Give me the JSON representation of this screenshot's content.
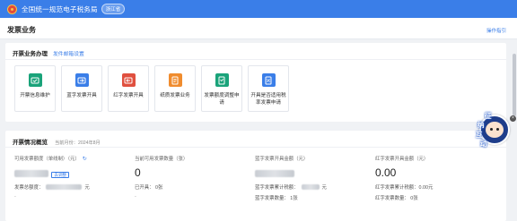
{
  "header": {
    "site_title": "全国统一规范电子税务局",
    "region_badge": "浙江省"
  },
  "page": {
    "title": "发票业务",
    "help_link": "操作指引"
  },
  "business": {
    "title": "开票业务办理",
    "settings_link": "发件邮箱设置",
    "tiles": [
      {
        "label": "开票信息维护",
        "icon": "info-maintenance-icon",
        "color": "#1aa37a"
      },
      {
        "label": "蓝字发票开具",
        "icon": "blue-invoice-icon",
        "color": "#3a7ee8"
      },
      {
        "label": "红字发票开具",
        "icon": "red-invoice-icon",
        "color": "#e0503f"
      },
      {
        "label": "纸质发票业务",
        "icon": "paper-invoice-icon",
        "color": "#f08c2e"
      },
      {
        "label": "发票额度调整申请",
        "icon": "quota-adjust-icon",
        "color": "#1aa37a"
      },
      {
        "label": "开具是否适用税率发票申请",
        "icon": "tax-rate-apply-icon",
        "color": "#3a7ee8"
      }
    ]
  },
  "overview": {
    "title": "开票情况概览",
    "period": "当前月份：2024年8月",
    "col1": {
      "label": "可用发票额度（单线制）（元）",
      "tag": "去调整",
      "sub1_label": "发票总额度：",
      "sub1_suffix": "元",
      "sub2": "-"
    },
    "col2": {
      "label": "当前可用发票数量（张）",
      "value": "0",
      "sub1": "已开具：  0张",
      "sub2": "-"
    },
    "col3": {
      "label": "蓝字发票开具金额（元）",
      "sub1_label": "蓝字发票累计税额：",
      "sub1_suffix": "元",
      "sub2": "蓝字发票数量：  1张"
    },
    "col4": {
      "label": "红字发票开具金额（元）",
      "value": "0.00",
      "sub1": "红字发票累计税额：0.00元",
      "sub2": "红字发票数量：  0张"
    }
  },
  "assistant": {
    "chars": [
      "征",
      "纳",
      "互",
      "动"
    ]
  }
}
